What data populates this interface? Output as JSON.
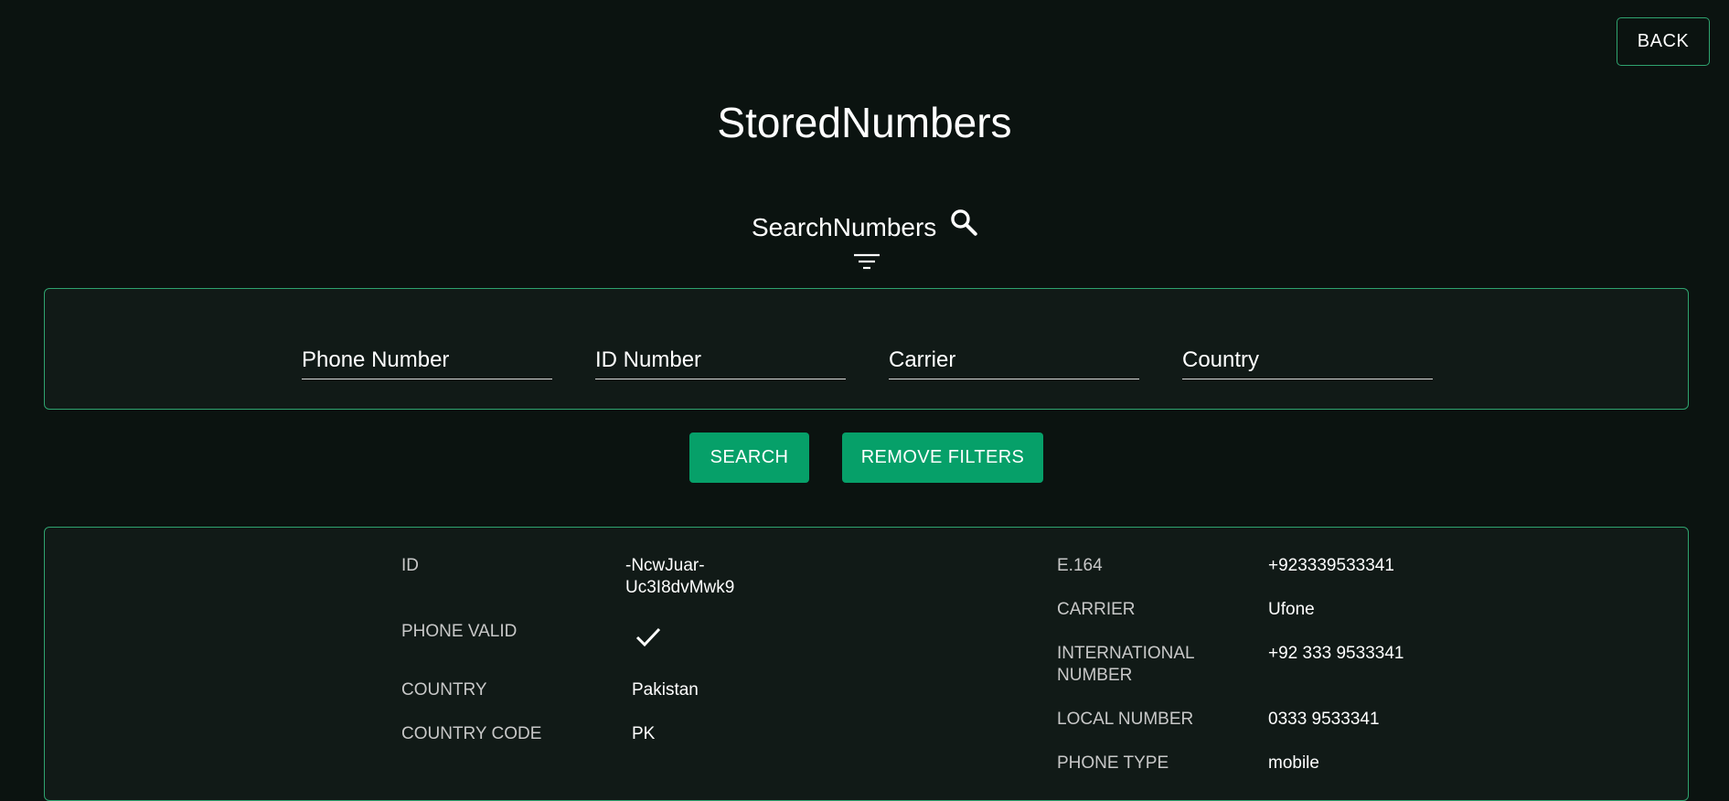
{
  "header": {
    "back_label": "BACK",
    "title": "StoredNumbers"
  },
  "search": {
    "title": "SearchNumbers",
    "icon": "search-icon",
    "filter_icon": "filter-icon",
    "fields": {
      "phone_number_placeholder": "Phone Number",
      "id_number_placeholder": "ID Number",
      "carrier_placeholder": "Carrier",
      "country_placeholder": "Country"
    },
    "search_label": "SEARCH",
    "remove_filters_label": "REMOVE FILTERS"
  },
  "record": {
    "id_label": "ID",
    "id_value_line1": "-NcwJuar-",
    "id_value_line2": "Uc3I8dvMwk9",
    "phone_valid_label": "PHONE VALID",
    "phone_valid_icon": "check-icon",
    "country_label": "COUNTRY",
    "country_value": "Pakistan",
    "country_code_label": "COUNTRY CODE",
    "country_code_value": "PK",
    "e164_label": "E.164",
    "e164_value": "+923339533341",
    "carrier_label": "CARRIER",
    "carrier_value": "Ufone",
    "international_label_line1": "INTERNATIONAL",
    "international_label_line2": "NUMBER",
    "international_value": "+92 333 9533341",
    "local_label": "LOCAL NUMBER",
    "local_value": "0333 9533341",
    "phone_type_label": "PHONE TYPE",
    "phone_type_value": "mobile"
  },
  "colors": {
    "background": "#0b1310",
    "panel": "#111a17",
    "accent": "#06a069",
    "border": "#2fa36f"
  }
}
